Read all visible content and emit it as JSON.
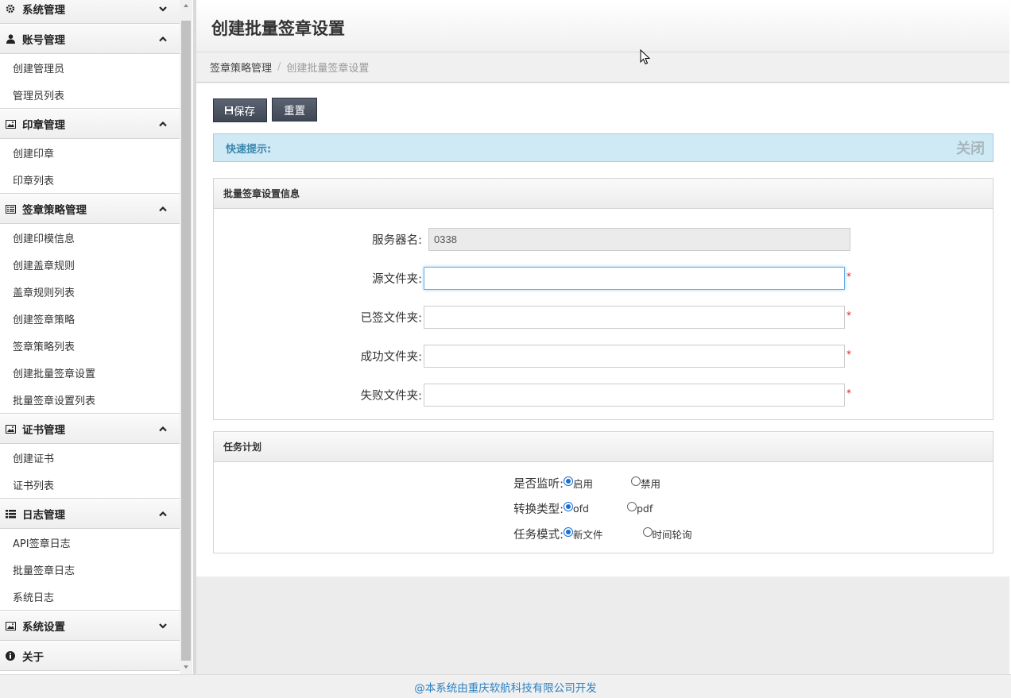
{
  "sidebar": {
    "groups": [
      {
        "label": "系统管理",
        "icon": "gear-icon",
        "expanded": false,
        "items": []
      },
      {
        "label": "账号管理",
        "icon": "user-icon",
        "expanded": true,
        "items": [
          "创建管理员",
          "管理员列表"
        ]
      },
      {
        "label": "印章管理",
        "icon": "picture-icon",
        "expanded": true,
        "items": [
          "创建印章",
          "印章列表"
        ]
      },
      {
        "label": "签章策略管理",
        "icon": "list-alt-icon",
        "expanded": true,
        "items": [
          "创建印模信息",
          "创建盖章规则",
          "盖章规则列表",
          "创建签章策略",
          "签章策略列表",
          "创建批量签章设置",
          "批量签章设置列表"
        ]
      },
      {
        "label": "证书管理",
        "icon": "picture-icon",
        "expanded": true,
        "items": [
          "创建证书",
          "证书列表"
        ]
      },
      {
        "label": "日志管理",
        "icon": "list-icon",
        "expanded": true,
        "items": [
          "API签章日志",
          "批量签章日志",
          "系统日志"
        ]
      },
      {
        "label": "系统设置",
        "icon": "picture-icon",
        "expanded": false,
        "items": []
      },
      {
        "label": "关于",
        "icon": "info-icon",
        "expanded": false,
        "items": []
      }
    ]
  },
  "header": {
    "title": "创建批量签章设置"
  },
  "breadcrumb": {
    "parent": "签章策略管理",
    "separator": "/",
    "current": "创建批量签章设置"
  },
  "toolbar": {
    "save_label": "保存",
    "reset_label": "重置"
  },
  "alert": {
    "label": "快速提示:",
    "close_label": "关闭"
  },
  "settings_panel": {
    "title": "批量签章设置信息",
    "fields": [
      {
        "label": "服务器名:",
        "value": "0338",
        "readonly": true,
        "required": false
      },
      {
        "label": "源文件夹:",
        "value": "",
        "readonly": false,
        "required": true,
        "focused": true
      },
      {
        "label": "已签文件夹:",
        "value": "",
        "readonly": false,
        "required": true
      },
      {
        "label": "成功文件夹:",
        "value": "",
        "readonly": false,
        "required": true
      },
      {
        "label": "失败文件夹:",
        "value": "",
        "readonly": false,
        "required": true
      }
    ],
    "required_mark": "*"
  },
  "task_panel": {
    "title": "任务计划",
    "rows": [
      {
        "label": "是否监听:",
        "options": [
          "启用",
          "禁用"
        ],
        "selected": 0
      },
      {
        "label": "转换类型:",
        "options": [
          "ofd",
          "pdf"
        ],
        "selected": 0
      },
      {
        "label": "任务模式:",
        "options": [
          "新文件",
          "时间轮询"
        ],
        "selected": 0
      }
    ]
  },
  "footer": {
    "text": "@本系统由重庆软航科技有限公司开发"
  },
  "colors": {
    "button": "#4a5260",
    "alert_bg": "#cfe9f5",
    "alert_text": "#3a87ad",
    "footer_text": "#2a7fc1",
    "required": "#e02020",
    "focus_border": "#66afe9"
  }
}
